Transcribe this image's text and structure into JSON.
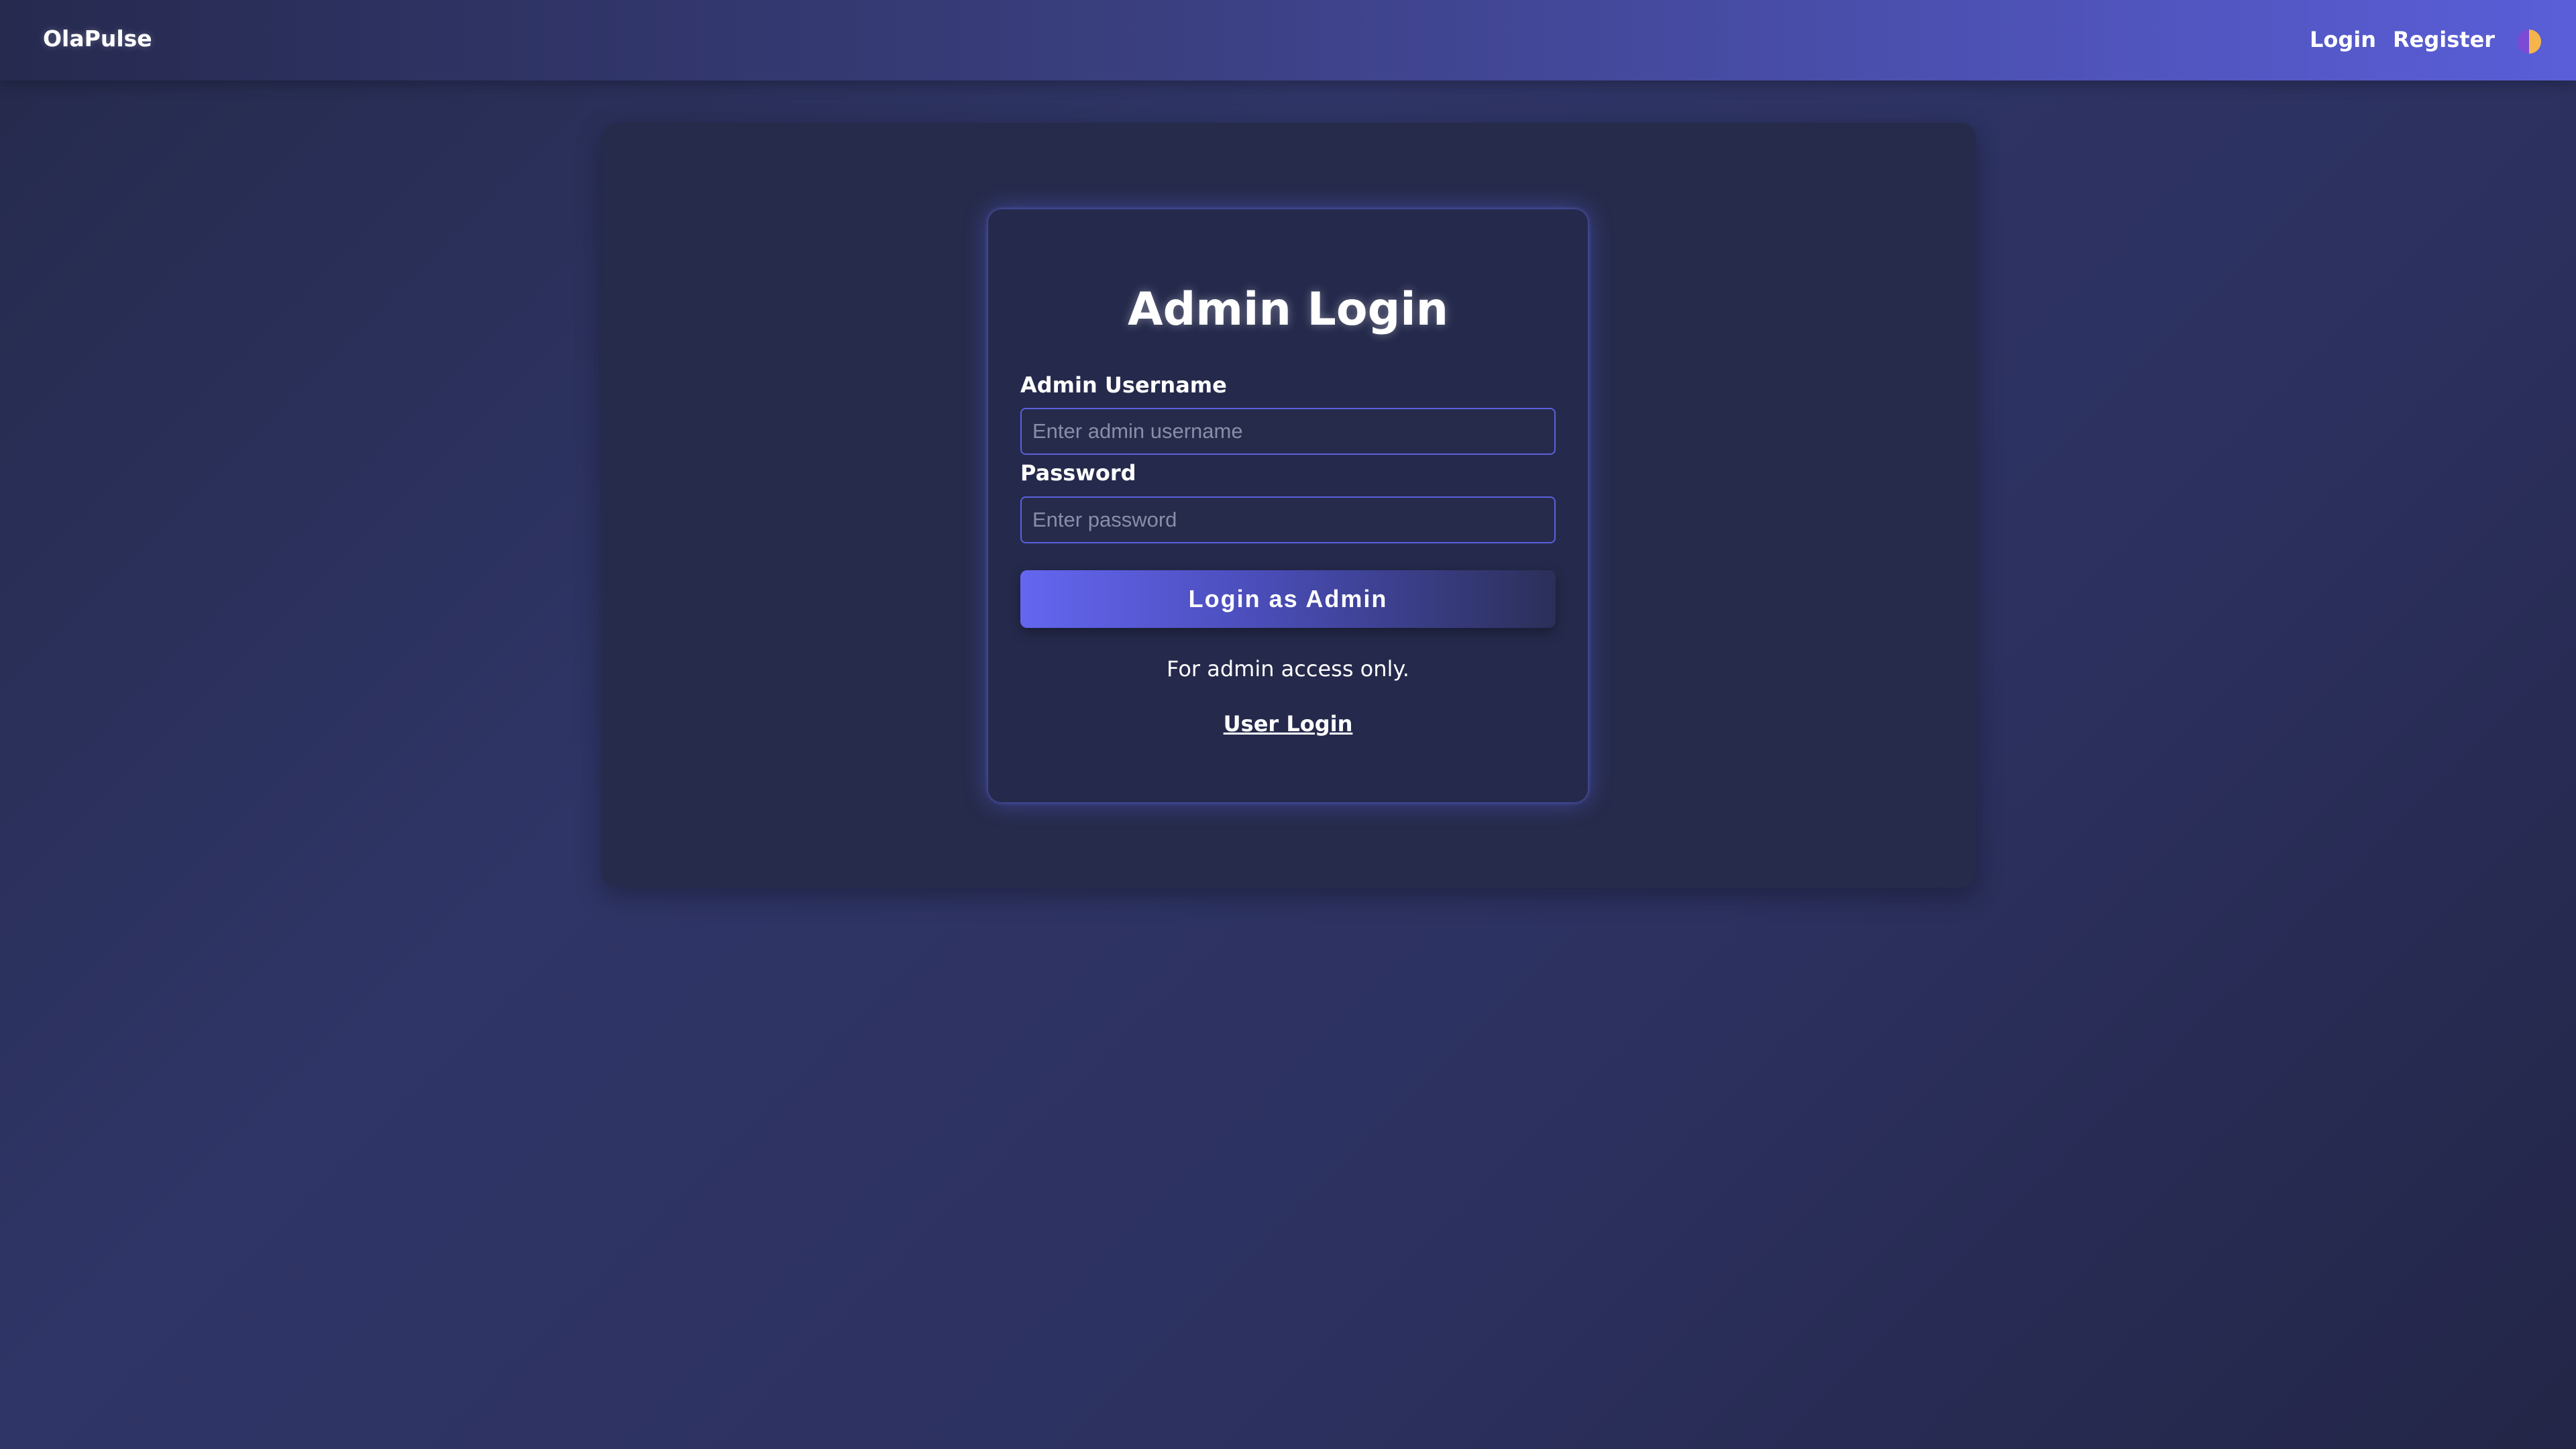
{
  "navbar": {
    "brand": "OlaPulse",
    "links": [
      {
        "label": "Login"
      },
      {
        "label": "Register"
      }
    ],
    "theme_toggle_icon": "half-moon-theme-icon"
  },
  "login": {
    "title": "Admin Login",
    "username": {
      "label": "Admin Username",
      "value": "",
      "placeholder": "Enter admin username"
    },
    "password": {
      "label": "Password",
      "value": "",
      "placeholder": "Enter password"
    },
    "submit_label": "Login as Admin",
    "note": "For admin access only.",
    "alt_link": "User Login"
  },
  "colors": {
    "accent": "#6466f0",
    "input_border": "#5b60dc",
    "background": "#2c3160",
    "card": "#252a4c"
  }
}
